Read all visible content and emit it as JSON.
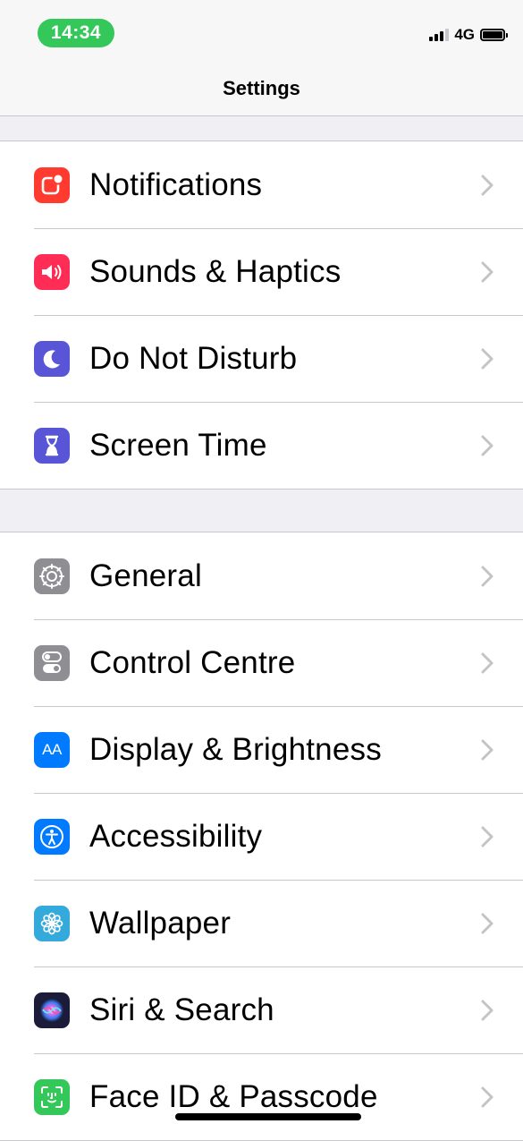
{
  "status_bar": {
    "time": "14:34",
    "network": "4G",
    "time_pill_color": "#34c759"
  },
  "nav": {
    "title": "Settings"
  },
  "groups": [
    {
      "items": [
        {
          "label": "Notifications",
          "icon": "notifications-icon",
          "color": "#ff3b30"
        },
        {
          "label": "Sounds & Haptics",
          "icon": "speaker-icon",
          "color": "#ff2d55"
        },
        {
          "label": "Do Not Disturb",
          "icon": "moon-icon",
          "color": "#5856d6"
        },
        {
          "label": "Screen Time",
          "icon": "hourglass-icon",
          "color": "#5856d6"
        }
      ]
    },
    {
      "items": [
        {
          "label": "General",
          "icon": "gear-icon",
          "color": "#8e8e93"
        },
        {
          "label": "Control Centre",
          "icon": "toggles-icon",
          "color": "#8e8e93"
        },
        {
          "label": "Display & Brightness",
          "icon": "text-size-icon",
          "color": "#007aff"
        },
        {
          "label": "Accessibility",
          "icon": "accessibility-icon",
          "color": "#007aff"
        },
        {
          "label": "Wallpaper",
          "icon": "flower-icon",
          "color": "#34aadc"
        },
        {
          "label": "Siri & Search",
          "icon": "siri-icon",
          "color": "#1c1c3a"
        },
        {
          "label": "Face ID & Passcode",
          "icon": "face-id-icon",
          "color": "#34c759"
        }
      ]
    }
  ],
  "icons": {
    "text_size_glyph": "AA"
  }
}
